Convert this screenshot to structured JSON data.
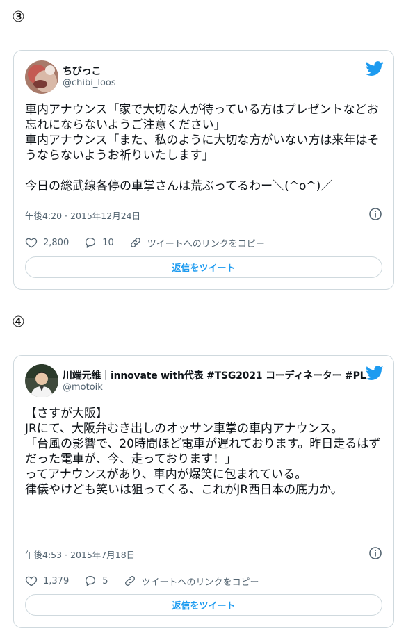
{
  "tweets": [
    {
      "marker": "③",
      "display_name": "ちびっこ",
      "handle": "@chibi_loos",
      "text": "車内アナウンス「家で大切な人が待っている方はプレゼントなどお忘れにならないようご注意ください」\n車内アナウンス「また、私のように大切な方がいない方は来年はそうならないようお祈りいたします」\n\n今日の総武線各停の車掌さんは荒ぶってるわー＼(^o^)／",
      "date": "午後4:20 · 2015年12月24日",
      "likes": "2,800",
      "replies": "10",
      "copy_link": "ツイートへのリンクをコピー",
      "reply_button": "返信をツイート"
    },
    {
      "marker": "④",
      "display_name": "川端元維｜innovate with代表 #TSG2021 コーディネーター #PL",
      "handle": "@motoik",
      "text": "【さすが大阪】\nJRにて、大阪弁むき出しのオッサン車掌の車内アナウンス。\n「台風の影響で、20時間ほど電車が遅れております。昨日走るはずだった電車が、今、走っております！」\nってアナウンスがあり、車内が爆笑に包まれている。\n律儀やけども笑いは狙ってくる、これがJR西日本の底力か。",
      "date": "午後4:53 · 2015年7月18日",
      "likes": "1,379",
      "replies": "5",
      "copy_link": "ツイートへのリンクをコピー",
      "reply_button": "返信をツイート"
    }
  ],
  "colors": {
    "accent": "#1d9bf0",
    "border": "#cfd9de",
    "muted": "#536471"
  },
  "icons": [
    "twitter-bird-icon",
    "info-icon",
    "heart-icon",
    "comment-icon",
    "link-icon"
  ]
}
